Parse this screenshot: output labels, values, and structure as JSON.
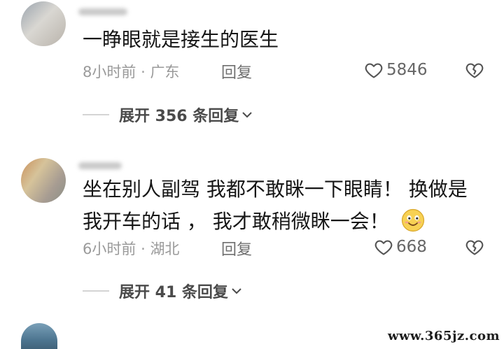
{
  "comments": [
    {
      "text_lines": [
        "一睁眼就是接生的医生"
      ],
      "time": "8小时前",
      "location": "广东",
      "reply_label": "回复",
      "likes": "5846",
      "expand_label": "展开 356 条回复"
    },
    {
      "text_lines": [
        "坐在别人副驾 我都不敢眯一下眼睛！ 换做是",
        "我开车的话 ， 我才敢稍微眯一会！"
      ],
      "time": "6小时前",
      "location": "湖北",
      "reply_label": "回复",
      "likes": "668",
      "expand_label": "展开 41 条回复"
    }
  ],
  "meta_separator": "·",
  "icons": {
    "like": "heart-outline-icon",
    "dislike": "broken-heart-icon",
    "expand": "chevron-down-icon",
    "emoji": "smiling-face-emoji"
  },
  "colors": {
    "text": "#161616",
    "meta": "#9a9a9a",
    "emoji_yellow": "#f7d154"
  },
  "watermark": "www.365jz.com"
}
